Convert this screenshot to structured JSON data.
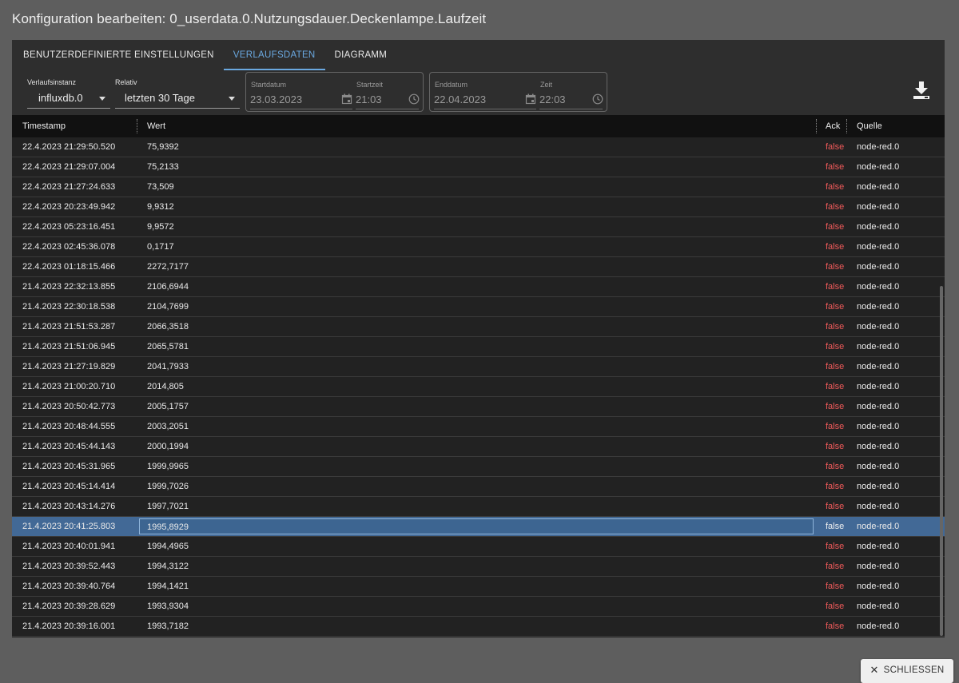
{
  "dialog": {
    "title": "Konfiguration bearbeiten: 0_userdata.0.Nutzungsdauer.Deckenlampe.Laufzeit",
    "close_label": "SCHLIESSEN"
  },
  "tabs": [
    {
      "label": "BENUTZERDEFINIERTE EINSTELLUNGEN",
      "active": false
    },
    {
      "label": "VERLAUFSDATEN",
      "active": true
    },
    {
      "label": "DIAGRAMM",
      "active": false
    }
  ],
  "toolbar": {
    "instance_label": "Verlaufsinstanz",
    "instance_value": "influxdb.0",
    "relative_label": "Relativ",
    "relative_value": "letzten 30 Tage",
    "start_date_label": "Startdatum",
    "start_date_value": "23.03.2023",
    "start_time_label": "Startzeit",
    "start_time_value": "21:03",
    "end_date_label": "Enddatum",
    "end_date_value": "22.04.2023",
    "end_time_label": "Zeit",
    "end_time_value": "22:03"
  },
  "table": {
    "columns": {
      "timestamp": "Timestamp",
      "value": "Wert",
      "ack": "Ack",
      "source": "Quelle"
    },
    "rows": [
      {
        "ts": "22.4.2023 21:29:50.520",
        "val": "75,9392",
        "ack": "false",
        "src": "node-red.0"
      },
      {
        "ts": "22.4.2023 21:29:07.004",
        "val": "75,2133",
        "ack": "false",
        "src": "node-red.0"
      },
      {
        "ts": "22.4.2023 21:27:24.633",
        "val": "73,509",
        "ack": "false",
        "src": "node-red.0"
      },
      {
        "ts": "22.4.2023 20:23:49.942",
        "val": "9,9312",
        "ack": "false",
        "src": "node-red.0"
      },
      {
        "ts": "22.4.2023 05:23:16.451",
        "val": "9,9572",
        "ack": "false",
        "src": "node-red.0"
      },
      {
        "ts": "22.4.2023 02:45:36.078",
        "val": "0,1717",
        "ack": "false",
        "src": "node-red.0"
      },
      {
        "ts": "22.4.2023 01:18:15.466",
        "val": "2272,7177",
        "ack": "false",
        "src": "node-red.0"
      },
      {
        "ts": "21.4.2023 22:32:13.855",
        "val": "2106,6944",
        "ack": "false",
        "src": "node-red.0"
      },
      {
        "ts": "21.4.2023 22:30:18.538",
        "val": "2104,7699",
        "ack": "false",
        "src": "node-red.0"
      },
      {
        "ts": "21.4.2023 21:51:53.287",
        "val": "2066,3518",
        "ack": "false",
        "src": "node-red.0"
      },
      {
        "ts": "21.4.2023 21:51:06.945",
        "val": "2065,5781",
        "ack": "false",
        "src": "node-red.0"
      },
      {
        "ts": "21.4.2023 21:27:19.829",
        "val": "2041,7933",
        "ack": "false",
        "src": "node-red.0"
      },
      {
        "ts": "21.4.2023 21:00:20.710",
        "val": "2014,805",
        "ack": "false",
        "src": "node-red.0"
      },
      {
        "ts": "21.4.2023 20:50:42.773",
        "val": "2005,1757",
        "ack": "false",
        "src": "node-red.0"
      },
      {
        "ts": "21.4.2023 20:48:44.555",
        "val": "2003,2051",
        "ack": "false",
        "src": "node-red.0"
      },
      {
        "ts": "21.4.2023 20:45:44.143",
        "val": "2000,1994",
        "ack": "false",
        "src": "node-red.0"
      },
      {
        "ts": "21.4.2023 20:45:31.965",
        "val": "1999,9965",
        "ack": "false",
        "src": "node-red.0"
      },
      {
        "ts": "21.4.2023 20:45:14.414",
        "val": "1999,7026",
        "ack": "false",
        "src": "node-red.0"
      },
      {
        "ts": "21.4.2023 20:43:14.276",
        "val": "1997,7021",
        "ack": "false",
        "src": "node-red.0"
      },
      {
        "ts": "21.4.2023 20:41:25.803",
        "val": "1995,8929",
        "ack": "false",
        "src": "node-red.0",
        "selected": true
      },
      {
        "ts": "21.4.2023 20:40:01.941",
        "val": "1994,4965",
        "ack": "false",
        "src": "node-red.0"
      },
      {
        "ts": "21.4.2023 20:39:52.443",
        "val": "1994,3122",
        "ack": "false",
        "src": "node-red.0"
      },
      {
        "ts": "21.4.2023 20:39:40.764",
        "val": "1994,1421",
        "ack": "false",
        "src": "node-red.0"
      },
      {
        "ts": "21.4.2023 20:39:28.629",
        "val": "1993,9304",
        "ack": "false",
        "src": "node-red.0"
      },
      {
        "ts": "21.4.2023 20:39:16.001",
        "val": "1993,7182",
        "ack": "false",
        "src": "node-red.0"
      }
    ]
  },
  "colors": {
    "accent": "#6aa8e0",
    "selected_row": "#426996",
    "ack_false": "#f05a5a"
  },
  "icons": {
    "download": "download-icon",
    "calendar": "calendar-icon",
    "clock": "clock-icon",
    "close": "close-icon"
  }
}
